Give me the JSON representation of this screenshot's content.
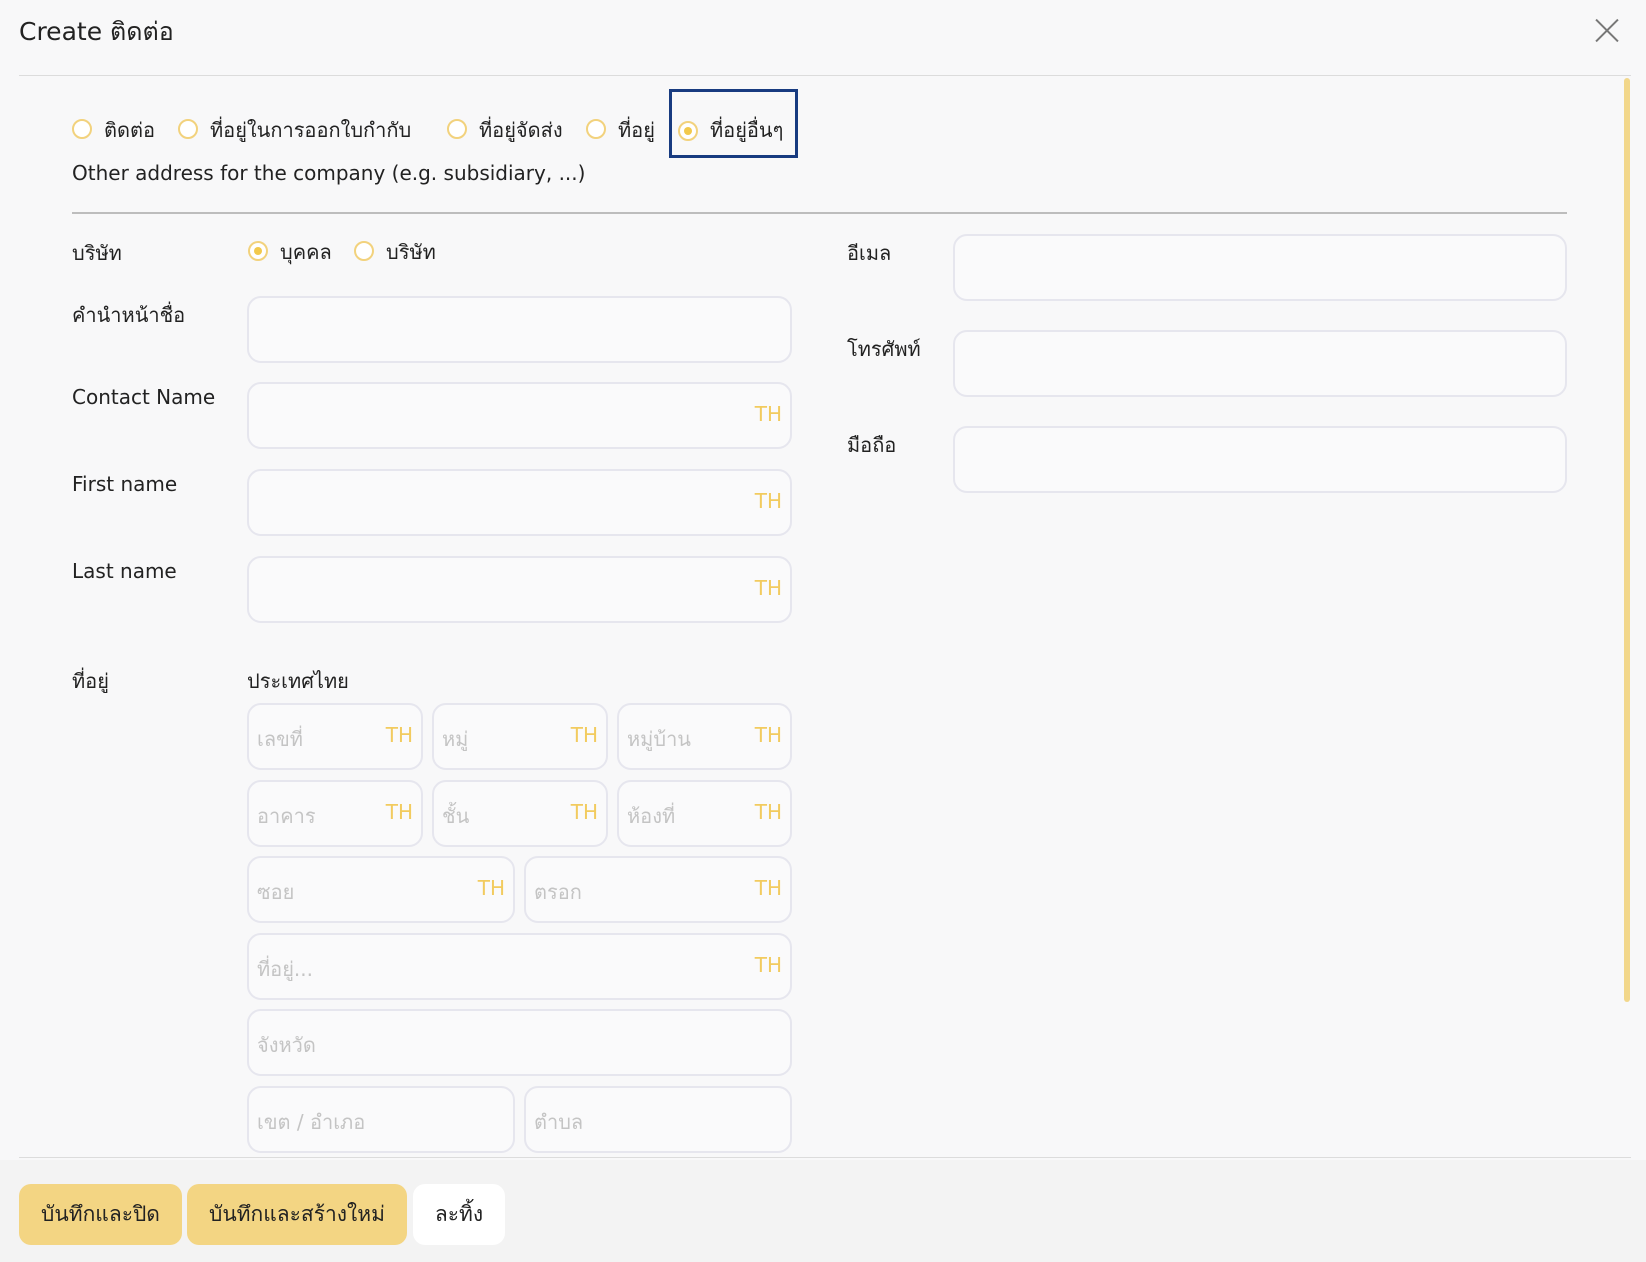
{
  "dialog": {
    "title": "Create ติดต่อ"
  },
  "address_types": [
    {
      "label": "ติดต่อ",
      "checked": false
    },
    {
      "label": "ที่อยู่ในการออกใบกำกับ",
      "checked": false
    },
    {
      "label": "ที่อยู่จัดส่ง",
      "checked": false
    },
    {
      "label": "ที่อยู่",
      "checked": false
    },
    {
      "label": "ที่อยู่อื่นๆ",
      "checked": true
    }
  ],
  "address_type_description": "Other address for the company (e.g. subsidiary, ...)",
  "form": {
    "company_label": "บริษัท",
    "company_options": [
      {
        "label": "บุคคล",
        "checked": true
      },
      {
        "label": "บริษัท",
        "checked": false
      }
    ],
    "title_label": "คำนำหน้าชื่อ",
    "contact_name_label": "Contact Name",
    "first_name_label": "First name",
    "last_name_label": "Last name",
    "lang_tag": "TH",
    "address_label": "ที่อยู่",
    "country_label": "ประเทศไทย",
    "address_placeholders": {
      "number": "เลขที่",
      "moo": "หมู่",
      "village": "หมู่บ้าน",
      "building": "อาคาร",
      "floor": "ชั้น",
      "room": "ห้องที่",
      "soi": "ซอย",
      "alley": "ตรอก",
      "street": "ที่อยู่...",
      "province": "จังหวัด",
      "district": "เขต / อำเภอ",
      "subdistrict": "ตำบล"
    },
    "email_label": "อีเมล",
    "phone_label": "โทรศัพท์",
    "mobile_label": "มือถือ"
  },
  "footer": {
    "save_close": "บันทึกและปิด",
    "save_new": "บันทึกและสร้างใหม่",
    "discard": "ละทิ้ง"
  },
  "colors": {
    "accent": "#f3d583",
    "focus": "#183b80",
    "radio": "#f2c94c"
  }
}
